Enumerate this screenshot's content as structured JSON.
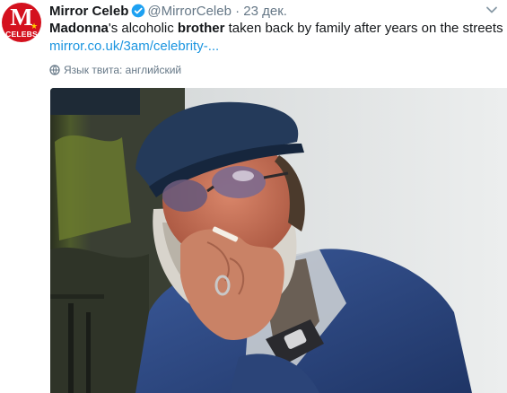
{
  "tweet": {
    "author_name": "Mirror Celeb",
    "handle": "@MirrorCeleb",
    "separator": "·",
    "date": "23 дек.",
    "text_parts": [
      "Madonna",
      "'s alcoholic ",
      "brother",
      " taken back by family after years on the streets"
    ],
    "link": "mirror.co.uk/3am/celebrity-...",
    "language_note": "Язык твита: английский"
  },
  "avatar": {
    "letter": "M",
    "subtext": "CELEBS",
    "background": "#d4111e"
  },
  "icons": {
    "verified": "verified-badge-icon",
    "menu": "chevron-down-icon",
    "language": "globe-icon"
  },
  "colors": {
    "link": "#1b95e0",
    "muted": "#657786",
    "verified": "#1da1f2"
  },
  "media": {
    "description_icon": "photo"
  }
}
